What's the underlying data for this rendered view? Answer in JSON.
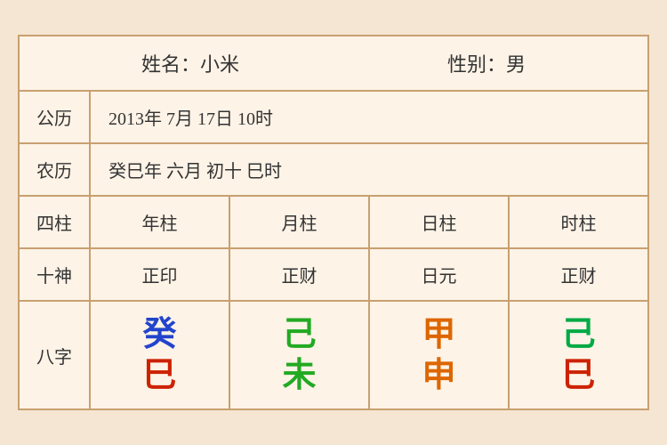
{
  "header": {
    "name_label": "姓名：小米",
    "gender_label": "性别：男"
  },
  "gregorian": {
    "label": "公历",
    "value": "2013年 7月 17日 10时"
  },
  "lunar": {
    "label": "农历",
    "value": "癸巳年 六月 初十 巳时"
  },
  "columns": {
    "label": "四柱",
    "items": [
      "年柱",
      "月柱",
      "日柱",
      "时柱"
    ]
  },
  "shishen": {
    "label": "十神",
    "items": [
      "正印",
      "正财",
      "日元",
      "正财"
    ]
  },
  "bazhi": {
    "label": "八字",
    "items": [
      {
        "top": "癸",
        "bottom": "巳",
        "top_color": "blue",
        "bottom_color": "red"
      },
      {
        "top": "己",
        "bottom": "未",
        "top_color": "green",
        "bottom_color": "green"
      },
      {
        "top": "甲",
        "bottom": "申",
        "top_color": "orange",
        "bottom_color": "orange"
      },
      {
        "top": "己",
        "bottom": "巳",
        "top_color": "dark-green",
        "bottom_color": "red"
      }
    ]
  }
}
